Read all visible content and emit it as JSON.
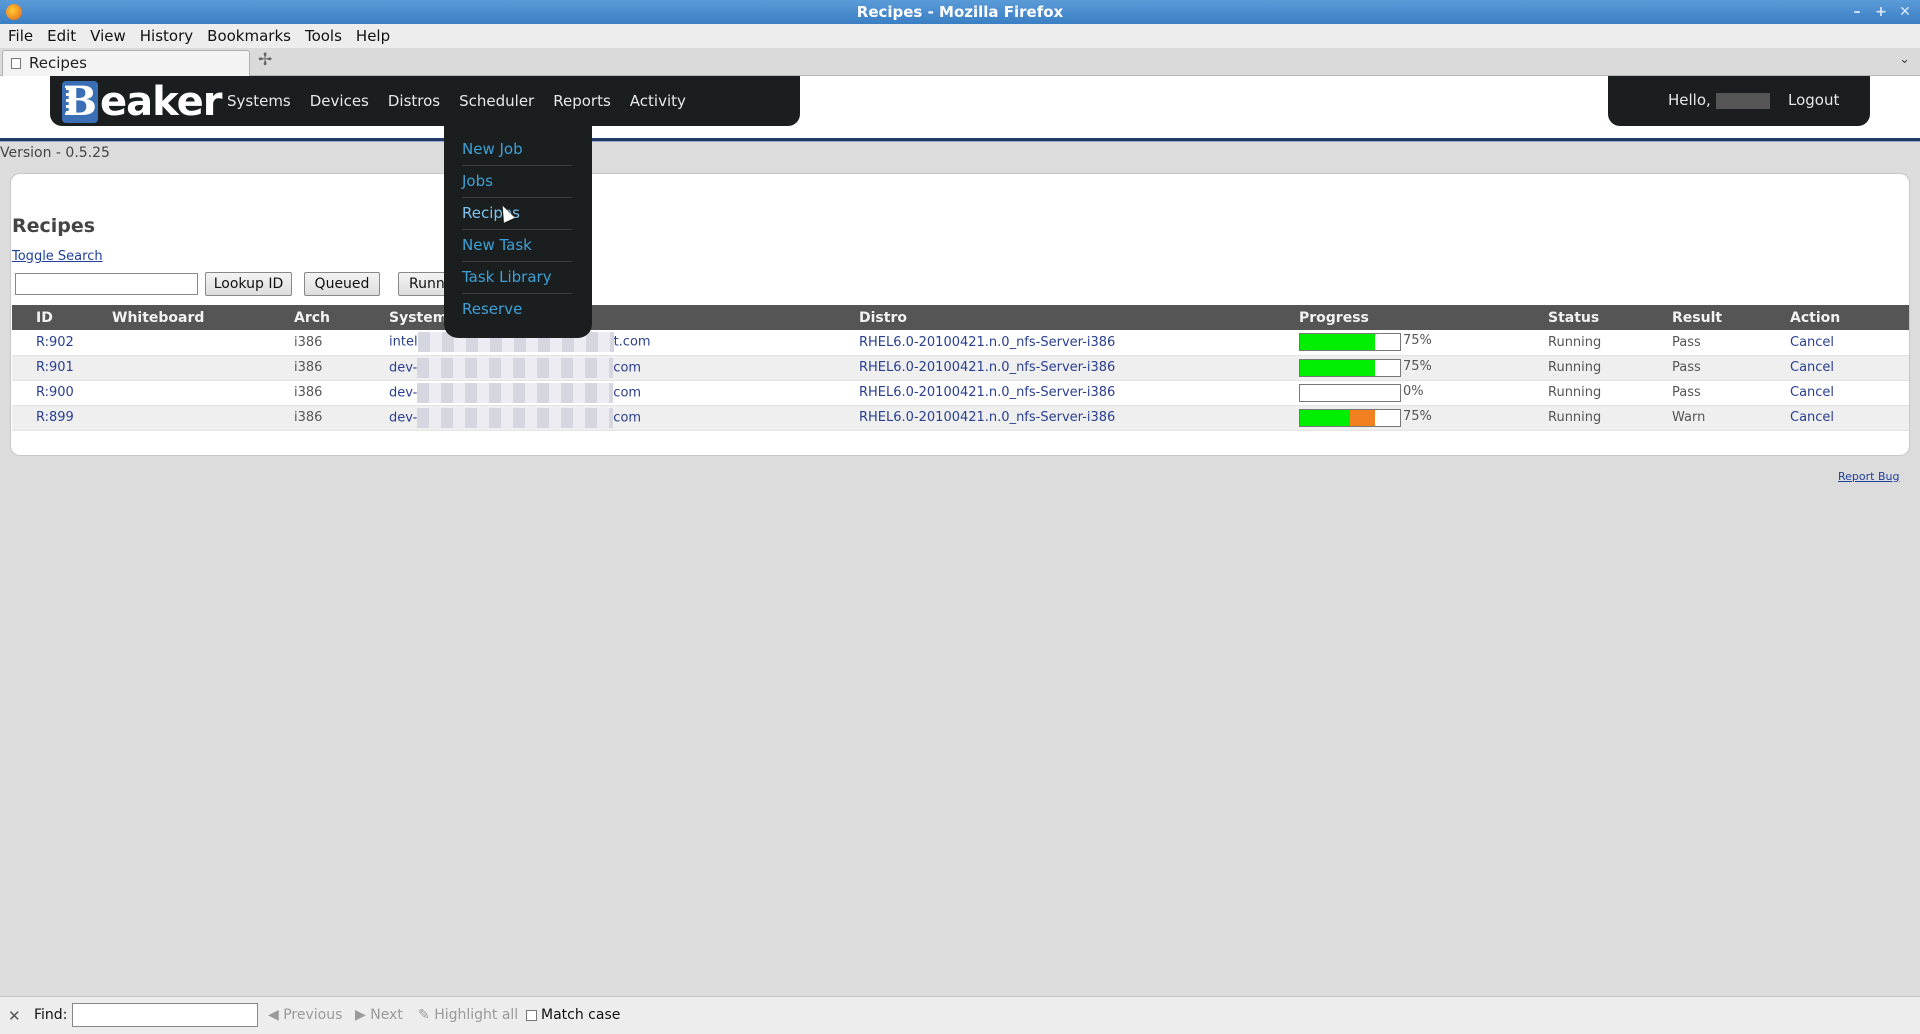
{
  "window": {
    "title": "Recipes - Mozilla Firefox"
  },
  "menubar": [
    "File",
    "Edit",
    "View",
    "History",
    "Bookmarks",
    "Tools",
    "Help"
  ],
  "tab": {
    "label": "Recipes"
  },
  "nav": {
    "logo_text": "Beaker",
    "logo_letter": "B",
    "links": [
      "Systems",
      "Devices",
      "Distros",
      "Scheduler",
      "Reports",
      "Activity"
    ],
    "hello": "Hello,",
    "logout": "Logout"
  },
  "version": "Version - 0.5.25",
  "dropdown": [
    "New Job",
    "Jobs",
    "Recipes",
    "New Task",
    "Task Library",
    "Reserve"
  ],
  "page": {
    "title": "Recipes",
    "toggle_search": "Toggle Search",
    "lookup_btn": "Lookup ID",
    "queued_btn": "Queued",
    "running_btn": "Running"
  },
  "table": {
    "headers": [
      "ID",
      "Whiteboard",
      "Arch",
      "System",
      "Distro",
      "Progress",
      "Status",
      "Result",
      "Action"
    ],
    "rows": [
      {
        "id": "R:902",
        "whiteboard": "",
        "arch": "i386",
        "sys_prefix": "intel",
        "sys_suffix": "t.com",
        "distro": "RHEL6.0-20100421.n.0_nfs-Server-i386",
        "pass": 0.75,
        "warn": 0,
        "pct": "75%",
        "status": "Running",
        "result": "Pass",
        "action": "Cancel"
      },
      {
        "id": "R:901",
        "whiteboard": "",
        "arch": "i386",
        "sys_prefix": "dev-",
        "sys_suffix": "com",
        "distro": "RHEL6.0-20100421.n.0_nfs-Server-i386",
        "pass": 0.75,
        "warn": 0,
        "pct": "75%",
        "status": "Running",
        "result": "Pass",
        "action": "Cancel"
      },
      {
        "id": "R:900",
        "whiteboard": "",
        "arch": "i386",
        "sys_prefix": "dev-",
        "sys_suffix": "com",
        "distro": "RHEL6.0-20100421.n.0_nfs-Server-i386",
        "pass": 0,
        "warn": 0,
        "pct": "0%",
        "status": "Running",
        "result": "Pass",
        "action": "Cancel"
      },
      {
        "id": "R:899",
        "whiteboard": "",
        "arch": "i386",
        "sys_prefix": "dev-",
        "sys_suffix": "com",
        "distro": "RHEL6.0-20100421.n.0_nfs-Server-i386",
        "pass": 0.5,
        "warn": 0.25,
        "pct": "75%",
        "status": "Running",
        "result": "Warn",
        "action": "Cancel"
      }
    ]
  },
  "report_bug": "Report Bug",
  "findbar": {
    "label": "Find:",
    "previous": "Previous",
    "next": "Next",
    "highlight": "Highlight all",
    "match_case": "Match case"
  },
  "colors": {
    "pass": "#00ee00",
    "warn": "#f08020",
    "accent": "#3fa0d6"
  }
}
